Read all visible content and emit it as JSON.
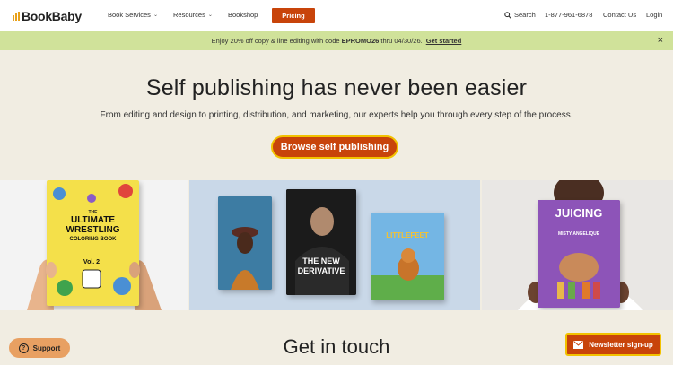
{
  "brand": {
    "name": "BookBaby"
  },
  "nav": {
    "book_services": "Book Services",
    "resources": "Resources",
    "bookshop": "Bookshop",
    "pricing": "Pricing",
    "search": "Search",
    "phone": "1-877-961-6878",
    "contact": "Contact Us",
    "login": "Login"
  },
  "promo": {
    "text_before": "Enjoy 20% off copy & line editing with code",
    "code": "EPROMO26",
    "text_after": "thru 04/30/26.",
    "link": "Get started",
    "close": "×"
  },
  "hero": {
    "title": "Self publishing has never been easier",
    "subtitle": "From editing and design to printing, distribution, and marketing, our experts help you through every step of the process.",
    "cta": "Browse self publishing"
  },
  "books": {
    "wrestling": {
      "line1": "THE",
      "line2": "ULTIMATE",
      "line3": "WRESTLING",
      "line4": "COLORING BOOK",
      "vol": "Vol. 2"
    },
    "derivative": {
      "line1": "THE NEW",
      "line2": "DERIVATIVE"
    },
    "littlefeet": {
      "line1": "LITTLEFEET"
    },
    "juicing": {
      "line1": "JUICING",
      "line2": "MISTY ANGELIQUE"
    }
  },
  "contact": {
    "title": "Get in touch"
  },
  "widgets": {
    "support": "Support",
    "newsletter": "Newsletter sign-up"
  },
  "colors": {
    "accent": "#c8440a",
    "promo_bg": "#d0e29a",
    "page_bg": "#f1ede2",
    "highlight_border": "#f2c200"
  },
  "icons": {
    "search": "search-icon",
    "chevron": "chevron-down-icon",
    "close": "close-icon",
    "support": "question-icon",
    "newsletter": "envelope-icon"
  }
}
